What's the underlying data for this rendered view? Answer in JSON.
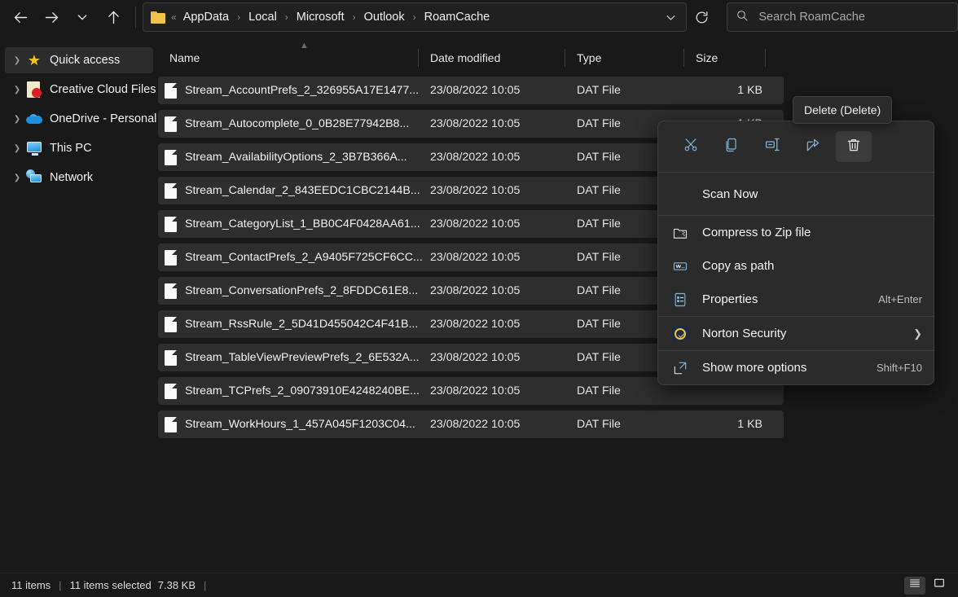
{
  "addressbar": {
    "back_icon": "arrow-left-icon",
    "forward_icon": "arrow-right-icon",
    "recent_icon": "chevron-down-icon",
    "up_icon": "arrow-up-icon",
    "folder_icon": "folder-icon",
    "overflow_marker": "«",
    "breadcrumbs": [
      "AppData",
      "Local",
      "Microsoft",
      "Outlook",
      "RoamCache"
    ],
    "path_dropdown_icon": "chevron-down-icon",
    "refresh_icon": "refresh-icon"
  },
  "search": {
    "placeholder": "Search RoamCache",
    "value": "",
    "icon": "search-icon"
  },
  "sidebar": {
    "items": [
      {
        "label": "Quick access",
        "icon": "star-icon",
        "selected": true
      },
      {
        "label": "Creative Cloud Files",
        "icon": "creative-cloud-icon",
        "selected": false
      },
      {
        "label": "OneDrive - Personal",
        "icon": "onedrive-cloud-icon",
        "selected": false
      },
      {
        "label": "This PC",
        "icon": "this-pc-icon",
        "selected": false
      },
      {
        "label": "Network",
        "icon": "network-icon",
        "selected": false
      }
    ]
  },
  "filelist": {
    "columns": [
      "Name",
      "Date modified",
      "Type",
      "Size"
    ],
    "sort_column": "Name",
    "sort_direction": "ascending",
    "rows": [
      {
        "name": "Stream_AccountPrefs_2_326955A17E1477...",
        "date": "23/08/2022 10:05",
        "type": "DAT File",
        "size": "1 KB",
        "selected": true
      },
      {
        "name": "Stream_Autocomplete_0_0B28E77942B8...",
        "date": "23/08/2022 10:05",
        "type": "DAT File",
        "size": "1 KB",
        "selected": true
      },
      {
        "name": "Stream_AvailabilityOptions_2_3B7B366A...",
        "date": "23/08/2022 10:05",
        "type": "DAT File",
        "size": "",
        "selected": true
      },
      {
        "name": "Stream_Calendar_2_843EEDC1CBC2144B...",
        "date": "23/08/2022 10:05",
        "type": "DAT File",
        "size": "",
        "selected": true
      },
      {
        "name": "Stream_CategoryList_1_BB0C4F0428AA61...",
        "date": "23/08/2022 10:05",
        "type": "DAT File",
        "size": "",
        "selected": true
      },
      {
        "name": "Stream_ContactPrefs_2_A9405F725CF6CC...",
        "date": "23/08/2022 10:05",
        "type": "DAT File",
        "size": "",
        "selected": true
      },
      {
        "name": "Stream_ConversationPrefs_2_8FDDC61E8...",
        "date": "23/08/2022 10:05",
        "type": "DAT File",
        "size": "",
        "selected": true
      },
      {
        "name": "Stream_RssRule_2_5D41D455042C4F41B...",
        "date": "23/08/2022 10:05",
        "type": "DAT File",
        "size": "",
        "selected": true
      },
      {
        "name": "Stream_TableViewPreviewPrefs_2_6E532A...",
        "date": "23/08/2022 10:05",
        "type": "DAT File",
        "size": "",
        "selected": true
      },
      {
        "name": "Stream_TCPrefs_2_09073910E4248240BE...",
        "date": "23/08/2022 10:05",
        "type": "DAT File",
        "size": "",
        "selected": true
      },
      {
        "name": "Stream_WorkHours_1_457A045F1203C04...",
        "date": "23/08/2022 10:05",
        "type": "DAT File",
        "size": "1 KB",
        "selected": true
      }
    ]
  },
  "tooltip": {
    "text": "Delete (Delete)"
  },
  "context_menu": {
    "toolbar": [
      {
        "name": "cut",
        "icon": "scissors-icon",
        "active": false
      },
      {
        "name": "copy",
        "icon": "copy-icon",
        "active": false
      },
      {
        "name": "rename",
        "icon": "rename-icon",
        "active": false
      },
      {
        "name": "share",
        "icon": "share-icon",
        "active": false
      },
      {
        "name": "delete",
        "icon": "trash-icon",
        "active": true
      }
    ],
    "items": [
      {
        "label": "Scan Now",
        "icon": "",
        "accel": "",
        "submenu": false
      },
      {
        "label": "Compress to Zip file",
        "icon": "zip-folder-icon",
        "accel": "",
        "submenu": false
      },
      {
        "label": "Copy as path",
        "icon": "copy-path-icon",
        "accel": "",
        "submenu": false
      },
      {
        "label": "Properties",
        "icon": "properties-icon",
        "accel": "Alt+Enter",
        "submenu": false
      },
      {
        "label": "Norton Security",
        "icon": "norton-icon",
        "accel": "",
        "submenu": true
      },
      {
        "label": "Show more options",
        "icon": "more-options-icon",
        "accel": "Shift+F10",
        "submenu": false
      }
    ]
  },
  "statusbar": {
    "item_count": "11 items",
    "selection": "11 items selected",
    "selection_size": "7.38 KB",
    "views": [
      {
        "name": "details-view",
        "icon": "details-view-icon",
        "active": true
      },
      {
        "name": "large-icons-view",
        "icon": "large-icons-view-icon",
        "active": false
      }
    ]
  },
  "colors": {
    "background": "#191919",
    "selection": "#2e2e2e",
    "menu": "#2b2b2b",
    "accent_blue": "#6fa8d4",
    "star_gold": "#f5c518"
  }
}
